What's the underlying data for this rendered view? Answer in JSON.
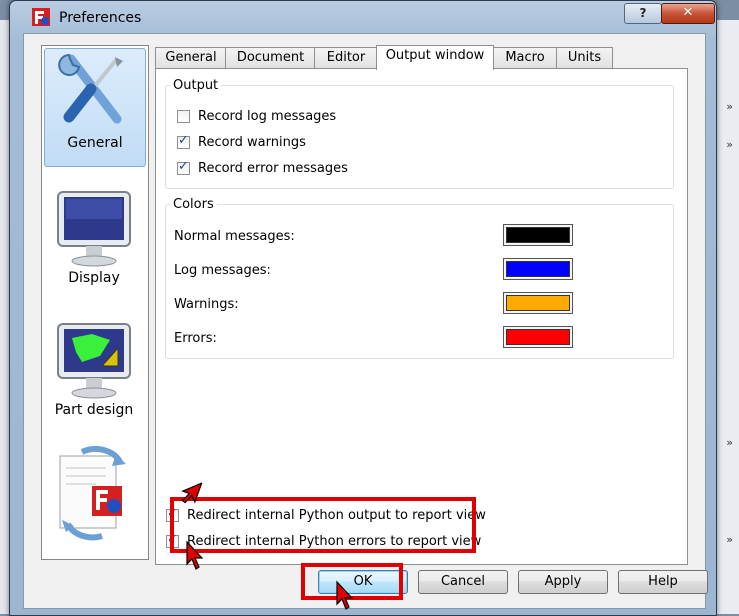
{
  "dialog": {
    "title": "Preferences",
    "help_glyph": "?",
    "close_glyph": "✕"
  },
  "categories": [
    {
      "label": "General",
      "icon": "wrench-screwdriver-icon",
      "selected": true
    },
    {
      "label": "Display",
      "icon": "monitor-icon",
      "selected": false
    },
    {
      "label": "Part design",
      "icon": "part-design-icon",
      "selected": false
    },
    {
      "label": "",
      "icon": "import-export-icon",
      "selected": false
    }
  ],
  "tabs": [
    "General",
    "Document",
    "Editor",
    "Output window",
    "Macro",
    "Units"
  ],
  "active_tab": "Output window",
  "output_group": {
    "title": "Output",
    "checkboxes": [
      {
        "label": "Record log messages",
        "checked": false
      },
      {
        "label": "Record warnings",
        "checked": true
      },
      {
        "label": "Record error messages",
        "checked": true
      }
    ]
  },
  "colors_group": {
    "title": "Colors",
    "rows": [
      {
        "label": "Normal messages:",
        "color": "#000000"
      },
      {
        "label": "Log messages:",
        "color": "#0000ff"
      },
      {
        "label": "Warnings:",
        "color": "#ffaa00"
      },
      {
        "label": "Errors:",
        "color": "#ff0000"
      }
    ]
  },
  "redirect": [
    {
      "label": "Redirect internal Python output to report view",
      "checked": true
    },
    {
      "label": "Redirect internal Python errors to report view",
      "checked": true
    }
  ],
  "buttons": {
    "ok": "OK",
    "cancel": "Cancel",
    "apply": "Apply",
    "help": "Help"
  },
  "highlight_color": "#e00000",
  "background_app": {
    "chevrons": [
      "»",
      "»",
      "»",
      "»"
    ]
  }
}
